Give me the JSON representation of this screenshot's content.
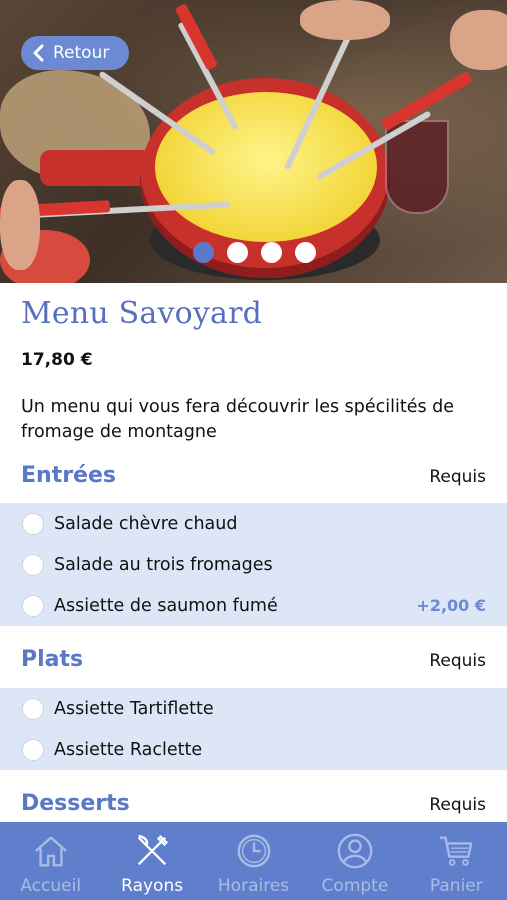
{
  "header": {
    "back_label": "Retour"
  },
  "carousel": {
    "count": 4,
    "active_index": 0
  },
  "menu": {
    "title": "Menu Savoyard",
    "price": "17,80 €",
    "description": "Un menu qui vous fera découvrir les spécilités de fromage de montagne"
  },
  "sections": [
    {
      "title": "Entrées",
      "requirement": "Requis",
      "options": [
        {
          "label": "Salade chèvre chaud",
          "extra": ""
        },
        {
          "label": "Salade au trois fromages",
          "extra": ""
        },
        {
          "label": "Assiette de saumon fumé",
          "extra": "+2,00 €"
        }
      ]
    },
    {
      "title": "Plats",
      "requirement": "Requis",
      "options": [
        {
          "label": "Assiette Tartiflette",
          "extra": ""
        },
        {
          "label": "Assiette Raclette",
          "extra": ""
        }
      ]
    },
    {
      "title": "Desserts",
      "requirement": "Requis",
      "options": []
    }
  ],
  "tabbar": {
    "items": [
      {
        "label": "Accueil",
        "icon": "home-icon",
        "active": false
      },
      {
        "label": "Rayons",
        "icon": "cutlery-icon",
        "active": true
      },
      {
        "label": "Horaires",
        "icon": "clock-icon",
        "active": false
      },
      {
        "label": "Compte",
        "icon": "user-icon",
        "active": false
      },
      {
        "label": "Panier",
        "icon": "cart-icon",
        "active": false
      }
    ]
  },
  "colors": {
    "accent": "#5f7fcc",
    "title": "#5670bf",
    "option_background": "#dde6f6",
    "tab_inactive": "#a9bbe6"
  }
}
